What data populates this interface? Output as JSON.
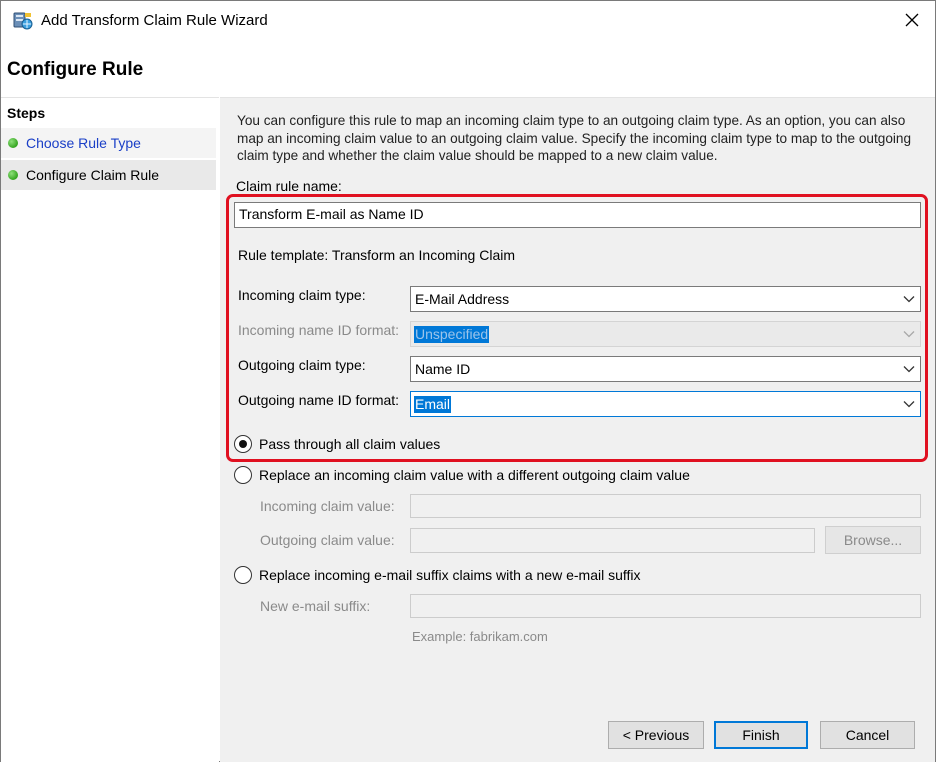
{
  "window": {
    "title": "Add Transform Claim Rule Wizard"
  },
  "header": {
    "title": "Configure Rule"
  },
  "steps": {
    "heading": "Steps",
    "items": [
      {
        "label": "Choose Rule Type",
        "status": "completed",
        "link": true
      },
      {
        "label": "Configure Claim Rule",
        "status": "current",
        "link": false
      }
    ]
  },
  "form": {
    "description": "You can configure this rule to map an incoming claim type to an outgoing claim type. As an option, you can also map an incoming claim value to an outgoing claim value. Specify the incoming claim type to map to the outgoing claim type and whether the claim value should be mapped to a new claim value.",
    "rule_name_label": "Claim rule name:",
    "rule_name_value": "Transform E-mail as Name ID",
    "rule_template_text": "Rule template: Transform an Incoming Claim",
    "incoming_claim_type_label": "Incoming claim type:",
    "incoming_claim_type_value": "E-Mail Address",
    "incoming_name_id_format_label": "Incoming name ID format:",
    "incoming_name_id_format_value": "Unspecified",
    "outgoing_claim_type_label": "Outgoing claim type:",
    "outgoing_claim_type_value": "Name ID",
    "outgoing_name_id_format_label": "Outgoing name ID format:",
    "outgoing_name_id_format_value": "Email",
    "options": {
      "pass_through_label": "Pass through all claim values",
      "replace_value_label": "Replace an incoming claim value with a different outgoing claim value",
      "incoming_claim_value_label": "Incoming claim value:",
      "incoming_claim_value": "",
      "outgoing_claim_value_label": "Outgoing claim value:",
      "outgoing_claim_value": "",
      "browse_label": "Browse...",
      "replace_suffix_label": "Replace incoming e-mail suffix claims with a new e-mail suffix",
      "new_suffix_label": "New e-mail suffix:",
      "new_suffix_value": "",
      "example_text": "Example: fabrikam.com",
      "selected": "pass_through"
    }
  },
  "footer": {
    "previous_label": "< Previous",
    "finish_label": "Finish",
    "cancel_label": "Cancel"
  },
  "colors": {
    "highlight_border": "#e01020",
    "link": "#1a3fc7",
    "selection": "#0078d7",
    "step_dot": "#34a51f"
  },
  "icons": {
    "app": "wizard-server-icon",
    "close": "close-icon",
    "dropdown": "chevron-down-icon",
    "step_status": "green-dot-icon"
  }
}
